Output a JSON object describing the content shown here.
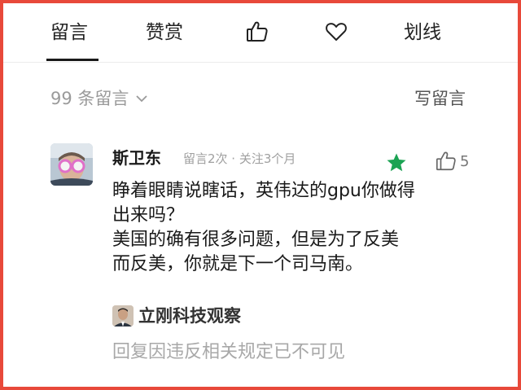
{
  "tabs": {
    "comments": "留言",
    "reward": "赞赏",
    "like_icon": "thumbs-up-icon",
    "heart_icon": "heart-icon",
    "highlight": "划线"
  },
  "comments_header": {
    "count_label": "99 条留言",
    "write_label": "写留言"
  },
  "comment": {
    "username": "斯卫东",
    "meta": "留言2次 · 关注3个月",
    "like_count": "5",
    "star_color": "#1ba353",
    "lines": [
      "睁着眼睛说瞎话，英伟达的gpu你做得",
      "出来吗？",
      "美国的确有很多问题，但是为了反美",
      "而反美，你就是下一个司马南。"
    ]
  },
  "reply": {
    "author": "立刚科技观察",
    "text": "回复因违反相关规定已不可见"
  }
}
